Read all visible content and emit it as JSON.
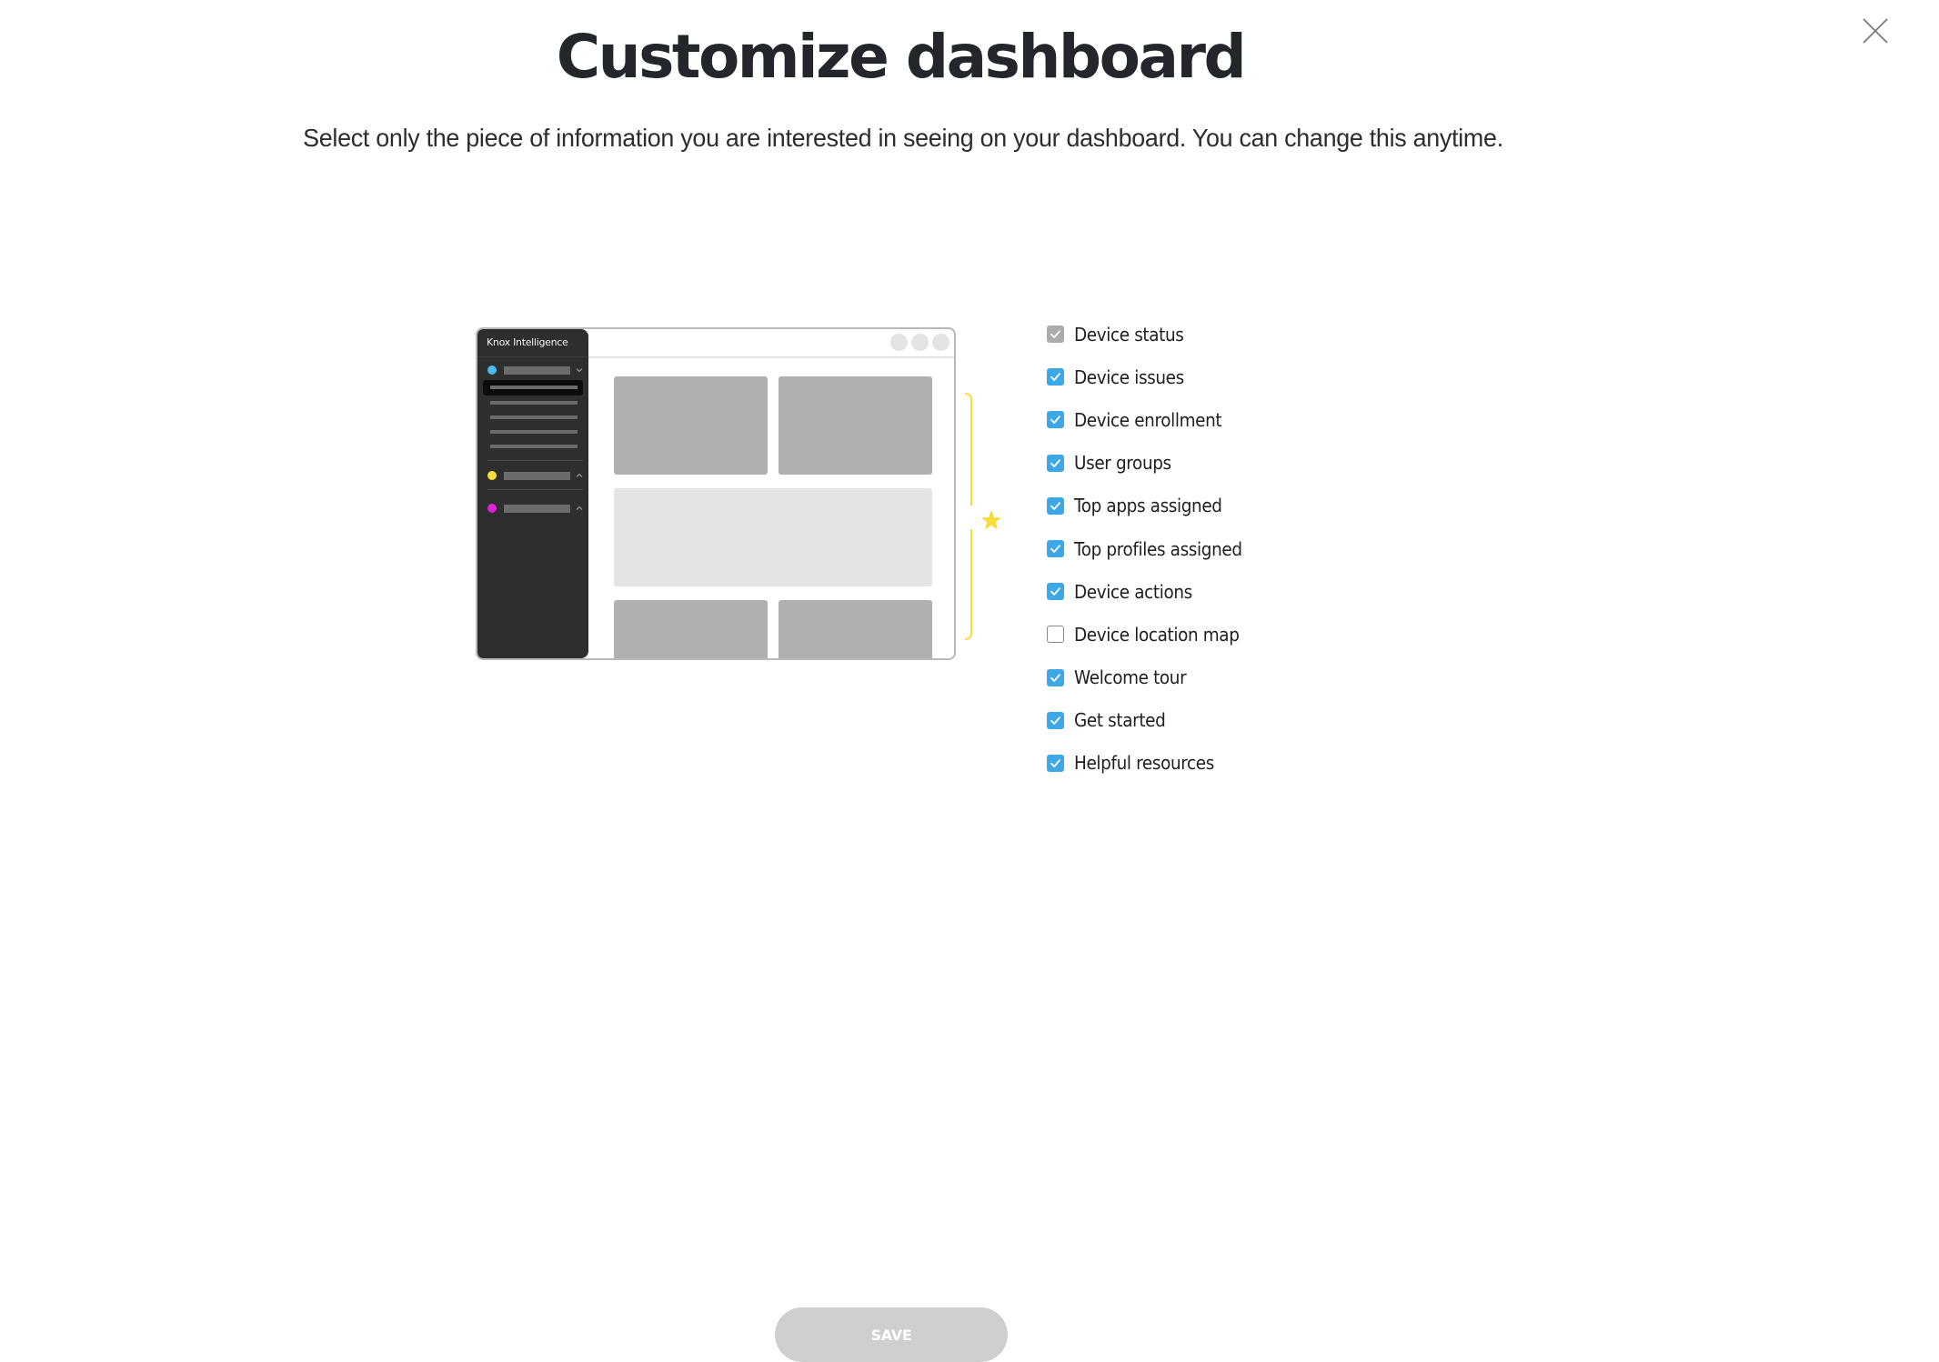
{
  "dialog": {
    "title": "Customize dashboard",
    "subtitle": "Select only the piece of information you are interested in seeing on your dashboard. You can change this anytime.",
    "close_icon": "close-icon"
  },
  "illustration": {
    "app_name": "Knox Intelligence",
    "sidebar_dot_colors": [
      "#4ab8ef",
      "#f8dc3a",
      "#e021d8"
    ],
    "accent_color": "#f8dc3a",
    "marker_icon": "star-icon"
  },
  "options": [
    {
      "label": "Device status",
      "checked": true,
      "disabled": true
    },
    {
      "label": "Device issues",
      "checked": true,
      "disabled": false
    },
    {
      "label": "Device enrollment",
      "checked": true,
      "disabled": false
    },
    {
      "label": "User groups",
      "checked": true,
      "disabled": false
    },
    {
      "label": "Top apps assigned",
      "checked": true,
      "disabled": false
    },
    {
      "label": "Top profiles assigned",
      "checked": true,
      "disabled": false
    },
    {
      "label": "Device actions",
      "checked": true,
      "disabled": false
    },
    {
      "label": "Device location map",
      "checked": false,
      "disabled": false
    },
    {
      "label": "Welcome tour",
      "checked": true,
      "disabled": false
    },
    {
      "label": "Get started",
      "checked": true,
      "disabled": false
    },
    {
      "label": "Helpful resources",
      "checked": true,
      "disabled": false
    }
  ],
  "footer": {
    "save_label": "SAVE",
    "save_enabled": false
  },
  "colors": {
    "checkbox_on": "#3da8e8",
    "checkbox_disabled": "#ababab",
    "button_disabled": "#cfcfcf"
  }
}
